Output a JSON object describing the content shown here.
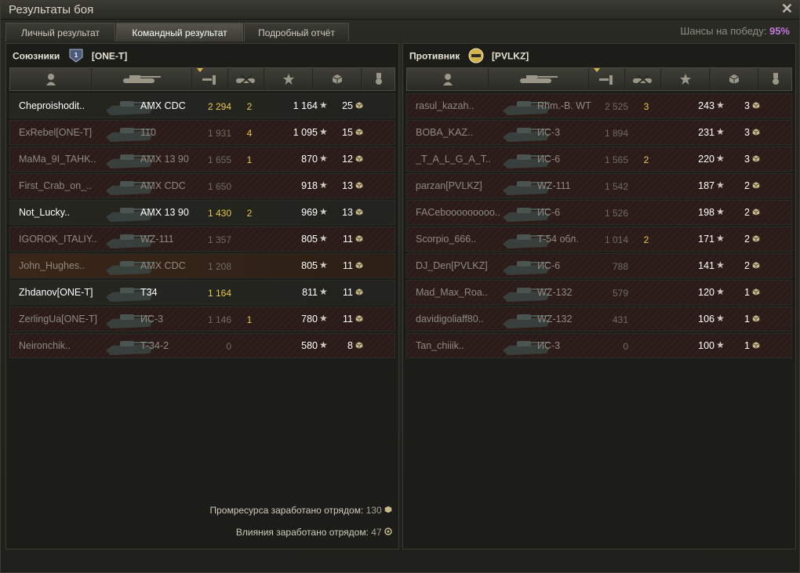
{
  "window": {
    "title": "Результаты боя"
  },
  "tabs": [
    {
      "label": "Личный результат",
      "active": false
    },
    {
      "label": "Командный результат",
      "active": true
    },
    {
      "label": "Подробный отчёт",
      "active": false
    }
  ],
  "win_chance": {
    "label": "Шансы на победу:",
    "value": "95%"
  },
  "allies": {
    "label": "Союзники",
    "clan": "[ONE-T]",
    "players": [
      {
        "name": "Cheproishodit..",
        "tank": "AMX CDC",
        "damage": "2 294",
        "kills": "2",
        "xp": "1 164",
        "resource": "25",
        "alive": true
      },
      {
        "name": "ExRebel[ONE-T]",
        "tank": "110",
        "damage": "1 931",
        "kills": "4",
        "xp": "1 095",
        "resource": "15",
        "alive": false
      },
      {
        "name": "MaMa_9I_TAHK..",
        "tank": "AMX 13 90",
        "damage": "1 655",
        "kills": "1",
        "xp": "870",
        "resource": "12",
        "alive": false
      },
      {
        "name": "First_Crab_on_..",
        "tank": "AMX CDC",
        "damage": "1 650",
        "kills": "",
        "xp": "918",
        "resource": "13",
        "alive": false
      },
      {
        "name": "Not_Lucky..",
        "tank": "AMX 13 90",
        "damage": "1 430",
        "kills": "2",
        "xp": "969",
        "resource": "13",
        "alive": true
      },
      {
        "name": "IGOROK_ITALIY..",
        "tank": "WZ-111",
        "damage": "1 357",
        "kills": "",
        "xp": "805",
        "resource": "11",
        "alive": false
      },
      {
        "name": "John_Hughes..",
        "tank": "AMX CDC",
        "damage": "1 208",
        "kills": "",
        "xp": "805",
        "resource": "11",
        "alive": false,
        "highlight": true
      },
      {
        "name": "Zhdanov[ONE-T]",
        "tank": "T34",
        "damage": "1 164",
        "kills": "",
        "xp": "811",
        "resource": "11",
        "alive": true
      },
      {
        "name": "ZerlingUa[ONE-T]",
        "tank": "ИС-3",
        "damage": "1 146",
        "kills": "1",
        "xp": "780",
        "resource": "11",
        "alive": false
      },
      {
        "name": "Neironchik..",
        "tank": "T-34-2",
        "damage": "0",
        "kills": "",
        "xp": "580",
        "resource": "8",
        "alive": false
      }
    ],
    "footer": [
      {
        "label": "Промресурса заработано отрядом:",
        "value": "130"
      },
      {
        "label": "Влияния заработано отрядом:",
        "value": "47"
      }
    ]
  },
  "enemies": {
    "label": "Противник",
    "clan": "[PVLKZ]",
    "players": [
      {
        "name": "rasul_kazah..",
        "tank": "Rhm.-B. WT",
        "damage": "2 525",
        "kills": "3",
        "xp": "243",
        "resource": "3",
        "alive": false
      },
      {
        "name": "BOBA_KAZ..",
        "tank": "ИС-3",
        "damage": "1 894",
        "kills": "",
        "xp": "231",
        "resource": "3",
        "alive": false
      },
      {
        "name": "_T_A_L_G_A_T..",
        "tank": "ИС-6",
        "damage": "1 565",
        "kills": "2",
        "xp": "220",
        "resource": "3",
        "alive": false
      },
      {
        "name": "parzan[PVLKZ]",
        "tank": "WZ-111",
        "damage": "1 542",
        "kills": "",
        "xp": "187",
        "resource": "2",
        "alive": false
      },
      {
        "name": "FACebooooooooo..",
        "tank": "ИС-6",
        "damage": "1 526",
        "kills": "",
        "xp": "198",
        "resource": "2",
        "alive": false
      },
      {
        "name": "Scorpio_666..",
        "tank": "T-54 обл.",
        "damage": "1 014",
        "kills": "2",
        "xp": "171",
        "resource": "2",
        "alive": false
      },
      {
        "name": "DJ_Den[PVLKZ]",
        "tank": "ИС-6",
        "damage": "788",
        "kills": "",
        "xp": "141",
        "resource": "2",
        "alive": false
      },
      {
        "name": "Mad_Max_Roa..",
        "tank": "WZ-132",
        "damage": "579",
        "kills": "",
        "xp": "120",
        "resource": "1",
        "alive": false
      },
      {
        "name": "davidigoliaff80..",
        "tank": "WZ-132",
        "damage": "431",
        "kills": "",
        "xp": "106",
        "resource": "1",
        "alive": false
      },
      {
        "name": "Tan_chiiik..",
        "tank": "ИС-3",
        "damage": "0",
        "kills": "",
        "xp": "100",
        "resource": "1",
        "alive": false
      }
    ]
  },
  "columns": [
    "player-icon",
    "tank-icon",
    "damage-icon",
    "kills-icon",
    "xp-icon",
    "resource-icon",
    "medal-icon"
  ],
  "colors": {
    "accent": "#e6c84a",
    "chance": "#c07ad8",
    "dead_row": "#2e1e1c"
  }
}
